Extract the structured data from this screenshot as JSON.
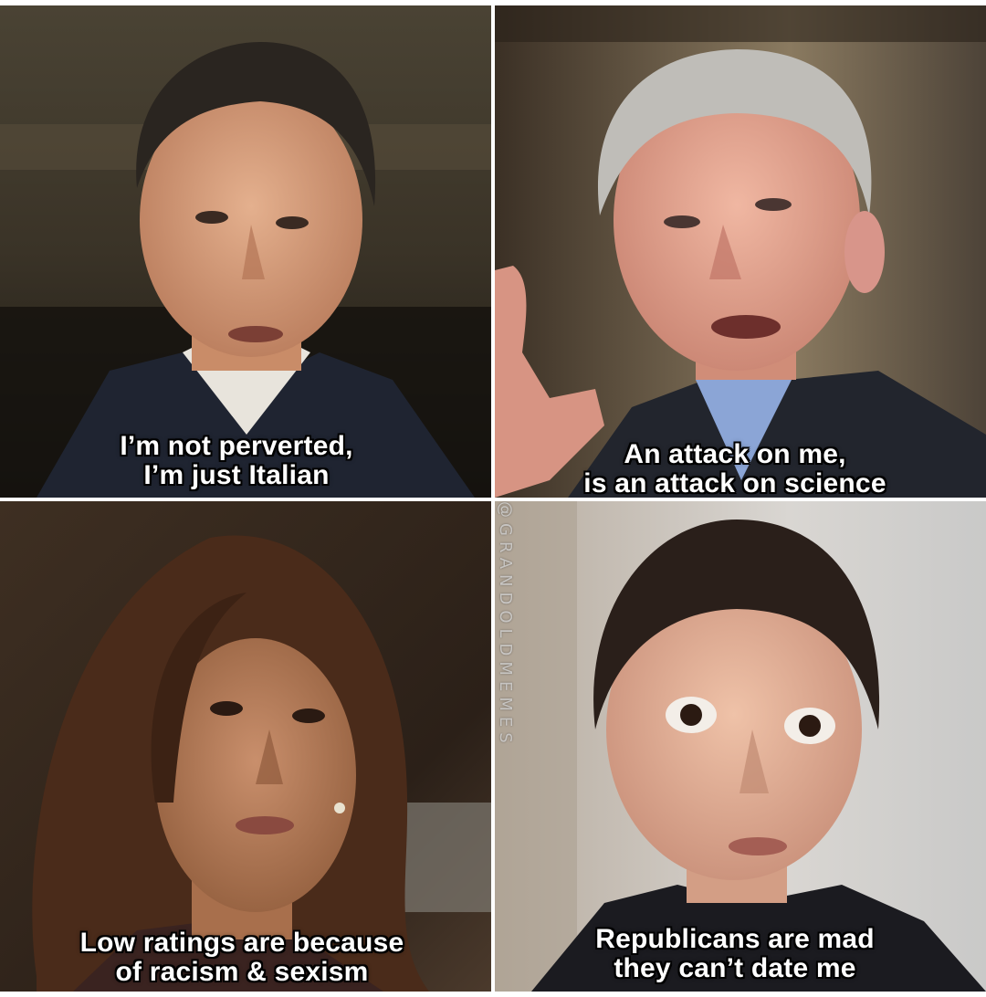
{
  "panels": [
    {
      "caption_lines": [
        "I’m not perverted,",
        "I’m just Italian"
      ]
    },
    {
      "caption_lines": [
        "An attack on me,",
        "is an attack on science"
      ]
    },
    {
      "caption_lines": [
        "Low ratings are because",
        "of racism & sexism"
      ]
    },
    {
      "caption_lines": [
        "Republicans are mad",
        "they can’t date me"
      ]
    }
  ],
  "watermark": "@GRANDOLDMEMES",
  "colors": {
    "caption_text": "#ffffff",
    "caption_outline": "#000000",
    "divider": "#ffffff"
  }
}
